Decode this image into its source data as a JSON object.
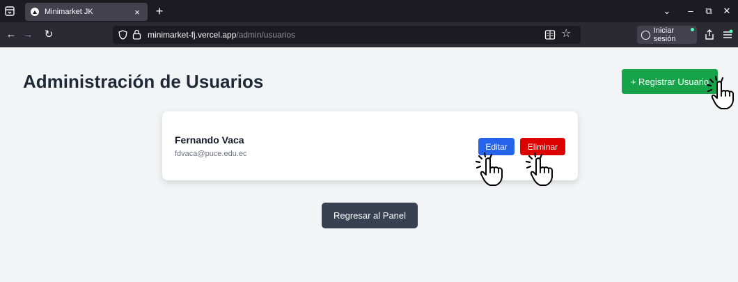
{
  "browser": {
    "tab_title": "Minimarket JK",
    "tab_close": "×",
    "new_tab": "+",
    "url_domain": "minimarket-fj.vercel.app",
    "url_path": "/admin/usuarios",
    "signin_label": "Iniciar sesión",
    "controls": {
      "list_all_tabs": "⌄",
      "minimize": "–",
      "restore": "⧉",
      "close": "✕"
    },
    "nav": {
      "back": "←",
      "forward": "→",
      "reload": "↻",
      "bookmark": "☆"
    },
    "icons": [
      "list-tabs-icon",
      "shield-icon",
      "lock-icon",
      "reader-mode-icon",
      "bookmark-star-icon",
      "account-icon",
      "share-icon",
      "app-menu-icon"
    ]
  },
  "page": {
    "title": "Administración de Usuarios",
    "register_button": "+ Registrar Usuario",
    "users": [
      {
        "name": "Fernando Vaca",
        "email": "fdvaca@puce.edu.ec",
        "edit_label": "Editar",
        "delete_label": "Eliminar"
      }
    ],
    "back_button": "Regresar al Panel",
    "colors": {
      "register": "#16a34a",
      "edit": "#2563eb",
      "delete": "#dc0000",
      "back": "#374151",
      "title": "#1f2937",
      "background": "#f3f4f6"
    }
  },
  "overlays": {
    "cursor_icon": "pointing-hand-click-icon"
  }
}
